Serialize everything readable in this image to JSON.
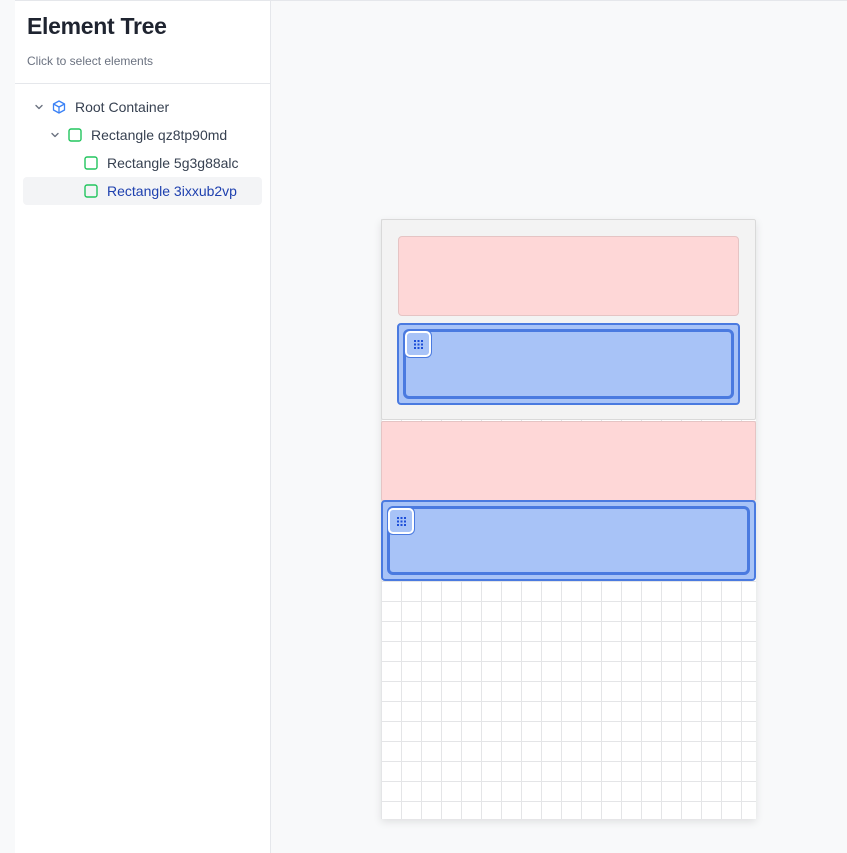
{
  "sidebar": {
    "title": "Element Tree",
    "subtitle": "Click to select elements",
    "tree": [
      {
        "label": "Root Container",
        "icon": "cube-icon",
        "expanded": true,
        "level": 0
      },
      {
        "label": "Rectangle qz8tp90md",
        "icon": "square-icon",
        "expanded": true,
        "level": 1
      },
      {
        "label": "Rectangle 5g3g88alc",
        "icon": "square-icon",
        "level": 2
      },
      {
        "label": "Rectangle 3ixxub2vp",
        "icon": "square-icon",
        "level": 2,
        "selected": true
      }
    ]
  },
  "colors": {
    "accent": "#4a7ae0",
    "blue_fill": "#a8c3f7",
    "red_fill": "#fed7d7",
    "tree_icon_green": "#22c55e",
    "tree_icon_blue": "#3b82f6",
    "selected_text": "#1e40af"
  },
  "canvas": {
    "drag_handle_icon": "grip-dots-icon"
  }
}
